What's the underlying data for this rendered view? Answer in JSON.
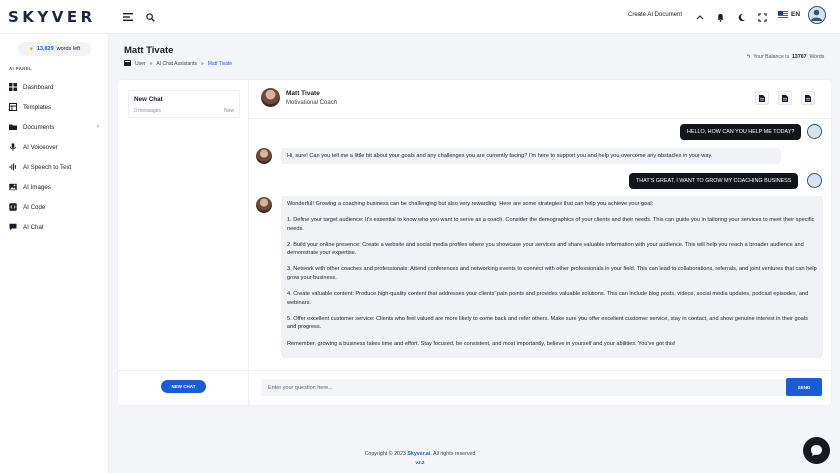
{
  "brand": {
    "logo": "SKYVER"
  },
  "topbar": {
    "create_document": "Create AI Document",
    "language": "EN"
  },
  "sidebar": {
    "words_count": "13,829",
    "words_label": "words left",
    "section_label": "AI PANEL",
    "items": [
      {
        "label": "Dashboard",
        "icon": "dashboard-icon"
      },
      {
        "label": "Templates",
        "icon": "templates-icon"
      },
      {
        "label": "Documents",
        "icon": "folder-icon"
      },
      {
        "label": "AI Voiceover",
        "icon": "microphone-icon"
      },
      {
        "label": "AI Speech to Text",
        "icon": "speech-icon"
      },
      {
        "label": "AI Images",
        "icon": "image-icon"
      },
      {
        "label": "AI Code",
        "icon": "code-icon"
      },
      {
        "label": "AI Chat",
        "icon": "chat-icon"
      }
    ]
  },
  "page": {
    "title": "Matt Tivate",
    "breadcrumb": [
      "User",
      "AI Chat Assistants",
      "Matt Tivate"
    ],
    "balance_label": "Your Balance is",
    "balance_value": "13767",
    "balance_unit": "Words"
  },
  "chat_list": {
    "item": {
      "name": "New Chat",
      "messages": "0 messages",
      "time": "Now"
    },
    "new_chat_label": "NEW CHAT"
  },
  "assistant": {
    "name": "Matt Tivate",
    "role": "Motivational Coach"
  },
  "messages": {
    "user_1": "HELLO, HOW CAN YOU HELP ME TODAY?",
    "bot_1": "Hi, sure! Can you tell me a little bit about your goals and any challenges you are currently facing? I'm here to support you and help you overcome any obstacles in your way.",
    "user_2": "THAT'S GREAT, I WANT TO GROW MY COACHING BUSINESS",
    "bot_2": [
      "Wonderful! Growing a coaching business can be challenging but also very rewarding. Here are some strategies that can help you achieve your goal:",
      "1. Define your target audience: It's essential to know who you want to serve as a coach. Consider the demographics of your clients and their needs. This can guide you in tailoring your services to meet their specific needs.",
      "2. Build your online presence: Create a website and social media profiles where you showcase your services and share valuable information with your audience. This will help you reach a broader audience and demonstrate your expertise.",
      "3. Network with other coaches and professionals: Attend conferences and networking events to connect with other professionals in your field. This can lead to collaborations, referrals, and joint ventures that can help grow your business.",
      "4. Create valuable content: Produce high-quality content that addresses your clients' pain points and provides valuable solutions. This can include blog posts, videos, social media updates, podcast episodes, and webinars.",
      "5. Offer excellent customer service: Clients who feel valued are more likely to come back and refer others. Make sure you offer excellent customer service, stay in contact, and show genuine interest in their goals and progress.",
      "Remember, growing a business takes time and effort. Stay focused, be consistent, and most importantly, believe in yourself and your abilities. You've got this!"
    ]
  },
  "composer": {
    "placeholder": "Enter your question here...",
    "send_label": "SEND"
  },
  "footer": {
    "copyright_prefix": "Copyright © 2023",
    "brand": "Skyver.ai",
    "copyright_suffix": ". All rights reserved",
    "version": "v2.2"
  },
  "colors": {
    "accent": "#1a5cd6",
    "dark": "#12141c",
    "bubble": "#f1f2f6"
  }
}
